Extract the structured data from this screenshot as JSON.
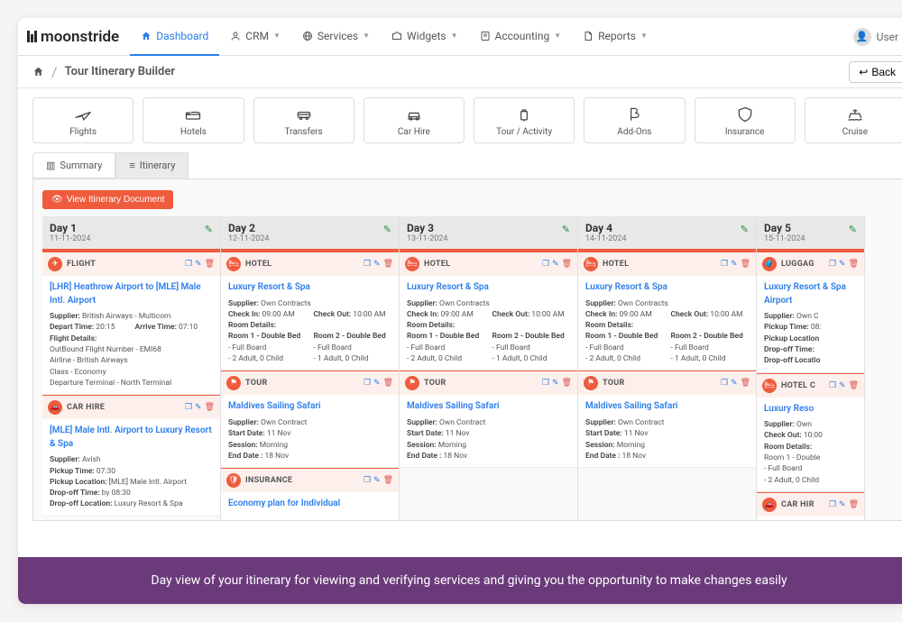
{
  "brand": "moonstride",
  "nav": [
    {
      "label": "Dashboard",
      "active": true
    },
    {
      "label": "CRM",
      "caret": true
    },
    {
      "label": "Services",
      "caret": true
    },
    {
      "label": "Widgets",
      "caret": true
    },
    {
      "label": "Accounting",
      "caret": true
    },
    {
      "label": "Reports",
      "caret": true
    }
  ],
  "user": {
    "label": "User"
  },
  "breadcrumb": {
    "title": "Tour Itinerary Builder",
    "back": "Back"
  },
  "categories": [
    {
      "label": "Flights"
    },
    {
      "label": "Hotels"
    },
    {
      "label": "Transfers"
    },
    {
      "label": "Car Hire"
    },
    {
      "label": "Tour / Activity"
    },
    {
      "label": "Add-Ons"
    },
    {
      "label": "Insurance"
    },
    {
      "label": "Cruise"
    }
  ],
  "tabs": [
    {
      "label": "Summary"
    },
    {
      "label": "Itinerary",
      "active": true
    }
  ],
  "view_doc": "View Itinerary Document",
  "days": [
    {
      "title": "Day 1",
      "date": "11-11-2024",
      "cards": [
        {
          "type": "FLIGHT",
          "badge": "plane",
          "title": "[LHR] Heathrow Airport to [MLE] Male Intl. Airport",
          "rows": [
            {
              "k": "Supplier:",
              "v": "British Airways - Multicom"
            },
            {
              "pair": [
                {
                  "k": "Depart Time:",
                  "v": "20:15"
                },
                {
                  "k": "Arrive Time:",
                  "v": "07:10"
                }
              ]
            },
            {
              "k": "Flight Details:",
              "v": ""
            },
            {
              "plain": "OutBound Flight Number - EMI68"
            },
            {
              "plain": "Airline - British Airways"
            },
            {
              "plain": "Class - Economy"
            },
            {
              "plain": "Departure Terminal - North Terminal"
            }
          ]
        },
        {
          "type": "CAR HIRE",
          "badge": "car",
          "title": "[MLE] Male Intl. Airport to Luxury Resort & Spa",
          "rows": [
            {
              "k": "Supplier:",
              "v": "Avish"
            },
            {
              "k": "Pickup Time:",
              "v": "07:30"
            },
            {
              "k": "Pickup Location:",
              "v": "[MLE] Male Intl. Airport"
            },
            {
              "k": "Drop-off Time:",
              "v": "by 08:30"
            },
            {
              "k": "Drop-off Location:",
              "v": "Luxury Resort & Spa"
            }
          ]
        }
      ]
    },
    {
      "title": "Day 2",
      "date": "12-11-2024",
      "cards": [
        {
          "type": "HOTEL",
          "badge": "bed",
          "title": "Luxury Resort & Spa",
          "rows": [
            {
              "k": "Supplier:",
              "v": "Own Contracts"
            },
            {
              "pair": [
                {
                  "k": "Check In:",
                  "v": "09:00 AM"
                },
                {
                  "k": "Check Out:",
                  "v": "10:00 AM"
                }
              ]
            },
            {
              "k": "Room Details:",
              "v": ""
            },
            {
              "pair": [
                {
                  "k": "Room 1 - Double Bed",
                  "v": ""
                },
                {
                  "k": "Room 2 - Double Bed",
                  "v": ""
                }
              ]
            },
            {
              "pair": [
                {
                  "plain": "- Full Board"
                },
                {
                  "plain": "- Full Board"
                }
              ]
            },
            {
              "pair": [
                {
                  "plain": "- 2 Adult, 0 Child"
                },
                {
                  "plain": "- 1 Adult, 0 Child"
                }
              ]
            }
          ]
        },
        {
          "type": "TOUR",
          "badge": "flag",
          "title": "Maldives Sailing Safari",
          "rows": [
            {
              "k": "Supplier:",
              "v": "Own Contract"
            },
            {
              "k": "Start Date:",
              "v": "11 Nov"
            },
            {
              "k": "Session:",
              "v": "Morning"
            },
            {
              "k": "End Date :",
              "v": "18 Nov"
            }
          ]
        },
        {
          "type": "INSURANCE",
          "badge": "shield",
          "title": "Economy plan for Individual",
          "rows": []
        }
      ]
    },
    {
      "title": "Day 3",
      "date": "13-11-2024",
      "cards": [
        {
          "type": "HOTEL",
          "badge": "bed",
          "title": "Luxury Resort & Spa",
          "rows": [
            {
              "k": "Supplier:",
              "v": "Own Contracts"
            },
            {
              "pair": [
                {
                  "k": "Check In:",
                  "v": "09:00 AM"
                },
                {
                  "k": "Check Out:",
                  "v": "10:00 AM"
                }
              ]
            },
            {
              "k": "Room Details:",
              "v": ""
            },
            {
              "pair": [
                {
                  "k": "Room 1 - Double Bed",
                  "v": ""
                },
                {
                  "k": "Room 2 - Double Bed",
                  "v": ""
                }
              ]
            },
            {
              "pair": [
                {
                  "plain": "- Full Board"
                },
                {
                  "plain": "- Full Board"
                }
              ]
            },
            {
              "pair": [
                {
                  "plain": "- 2 Adult, 0 Child"
                },
                {
                  "plain": "- 1 Adult, 0 Child"
                }
              ]
            }
          ]
        },
        {
          "type": "TOUR",
          "badge": "flag",
          "title": "Maldives Sailing Safari",
          "rows": [
            {
              "k": "Supplier:",
              "v": "Own Contract"
            },
            {
              "k": "Start Date:",
              "v": "11 Nov"
            },
            {
              "k": "Session:",
              "v": "Morning"
            },
            {
              "k": "End Date :",
              "v": "18 Nov"
            }
          ]
        }
      ]
    },
    {
      "title": "Day 4",
      "date": "14-11-2024",
      "cards": [
        {
          "type": "HOTEL",
          "badge": "bed",
          "title": "Luxury Resort & Spa",
          "rows": [
            {
              "k": "Supplier:",
              "v": "Own Contracts"
            },
            {
              "pair": [
                {
                  "k": "Check In:",
                  "v": "09:00 AM"
                },
                {
                  "k": "Check Out:",
                  "v": "10:00 AM"
                }
              ]
            },
            {
              "k": "Room Details:",
              "v": ""
            },
            {
              "pair": [
                {
                  "k": "Room 1 - Double Bed",
                  "v": ""
                },
                {
                  "k": "Room 2 - Double Bed",
                  "v": ""
                }
              ]
            },
            {
              "pair": [
                {
                  "plain": "- Full Board"
                },
                {
                  "plain": "- Full Board"
                }
              ]
            },
            {
              "pair": [
                {
                  "plain": "- 2 Adult, 0 Child"
                },
                {
                  "plain": "- 1 Adult, 0 Child"
                }
              ]
            }
          ]
        },
        {
          "type": "TOUR",
          "badge": "flag",
          "title": "Maldives Sailing Safari",
          "rows": [
            {
              "k": "Supplier:",
              "v": "Own Contract"
            },
            {
              "k": "Start Date:",
              "v": "11 Nov"
            },
            {
              "k": "Session:",
              "v": "Morning"
            },
            {
              "k": "End Date :",
              "v": "18 Nov"
            }
          ]
        }
      ]
    },
    {
      "title": "Day 5",
      "date": "15-11-2024",
      "cards": [
        {
          "type": "LUGGAG",
          "badge": "bag",
          "title": "Luxury Resort & Spa Airport",
          "rows": [
            {
              "k": "Supplier:",
              "v": "Own C"
            },
            {
              "k": "Pickup Time:",
              "v": "08:"
            },
            {
              "k": "Pickup Location",
              "v": ""
            },
            {
              "k": "Drop-off Time:",
              "v": ""
            },
            {
              "k": "Drop-off Locatio",
              "v": ""
            }
          ]
        },
        {
          "type": "HOTEL C",
          "badge": "bed",
          "title": "Luxury Reso",
          "rows": [
            {
              "k": "Supplier:",
              "v": "Own"
            },
            {
              "k": "Check Out:",
              "v": "10:00"
            },
            {
              "k": "Room Details:",
              "v": ""
            },
            {
              "plain": "Room 1 - Double"
            },
            {
              "plain": "- Full Board"
            },
            {
              "plain": "- 2 Adult, 0 Child"
            }
          ]
        },
        {
          "type": "CAR HIR",
          "badge": "car",
          "title": "",
          "rows": []
        }
      ]
    }
  ],
  "caption": "Day view of your itinerary for viewing and verifying services and giving you the opportunity to make changes easily"
}
